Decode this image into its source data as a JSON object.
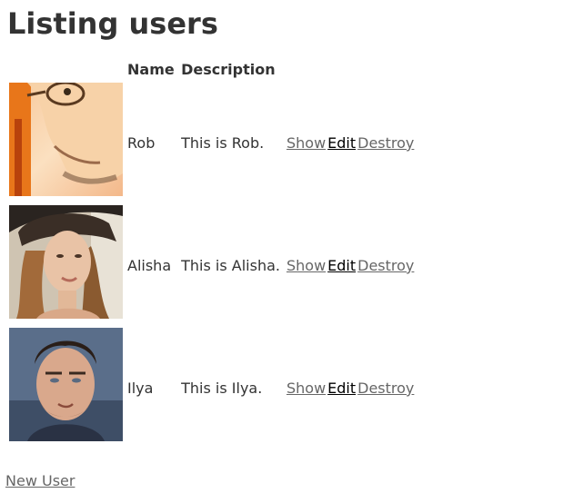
{
  "page": {
    "title": "Listing users",
    "new_user_label": "New User"
  },
  "table": {
    "headers": {
      "name": "Name",
      "description": "Description"
    },
    "rows": [
      {
        "name": "Rob",
        "description": "This is Rob.",
        "show": "Show",
        "edit": "Edit",
        "destroy": "Destroy",
        "avatar": "rob-photo"
      },
      {
        "name": "Alisha",
        "description": "This is Alisha.",
        "show": "Show",
        "edit": "Edit",
        "destroy": "Destroy",
        "avatar": "alisha-photo"
      },
      {
        "name": "Ilya",
        "description": "This is Ilya.",
        "show": "Show",
        "edit": "Edit",
        "destroy": "Destroy",
        "avatar": "ilya-photo"
      }
    ]
  },
  "colors": {
    "text": "#333333",
    "link": "#666666",
    "edit_link": "#000000",
    "background": "#ffffff"
  }
}
